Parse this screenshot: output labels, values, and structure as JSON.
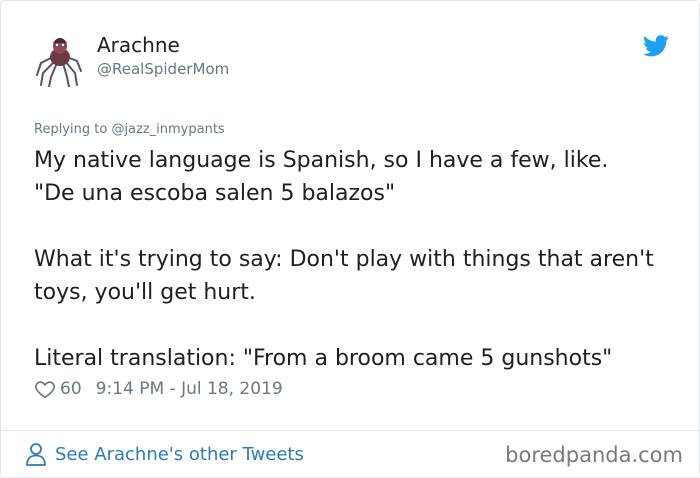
{
  "author": {
    "name": "Arachne",
    "handle": "@RealSpiderMom"
  },
  "reply": {
    "prefix": "Replying to",
    "mention": "@jazz_inmypants"
  },
  "tweet": {
    "text": "My native language is Spanish, so I have a few, like.\n\"De una escoba salen 5 balazos\"\n\nWhat it's trying to say: Don't play with things that aren't toys, you'll get hurt.\n\nLiteral translation: \"From a broom came 5 gunshots\""
  },
  "meta": {
    "likes": "60",
    "timestamp": "9:14 PM - Jul 18, 2019"
  },
  "footer": {
    "see_more": "See Arachne's other Tweets",
    "watermark": "boredpanda.com"
  },
  "colors": {
    "link": "#2b7bb9",
    "twitter_blue": "#1da1f2",
    "muted": "#697882"
  },
  "icons": {
    "brand": "twitter-bird-icon",
    "like": "heart-icon",
    "profile": "person-icon"
  }
}
